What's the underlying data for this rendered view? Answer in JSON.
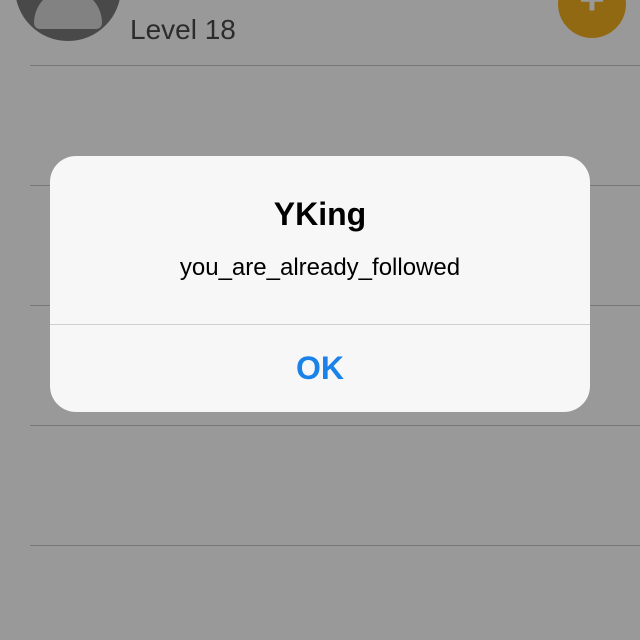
{
  "list": {
    "rows": [
      {
        "level": "Level 18"
      }
    ]
  },
  "icons": {
    "follow_button": "plus-icon",
    "avatar": "avatar-icon"
  },
  "colors": {
    "follow_button": "#f2b01e",
    "alert_button_text": "#1a82e8",
    "overlay": "rgba(0,0,0,0.40)"
  },
  "alert": {
    "title": "YKing",
    "message": "you_are_already_followed",
    "button_label": "OK"
  }
}
